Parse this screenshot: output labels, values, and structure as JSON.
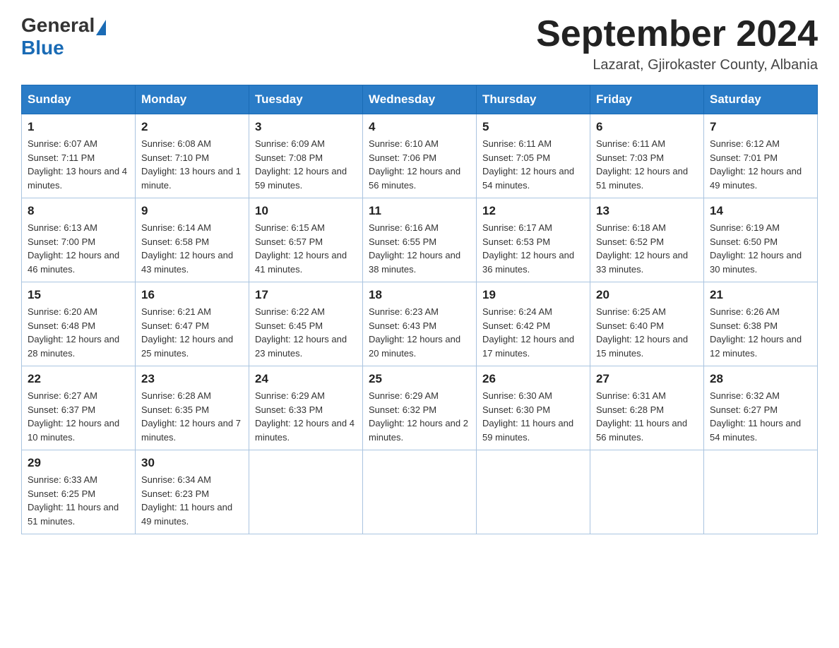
{
  "header": {
    "logo": {
      "general": "General",
      "blue": "Blue"
    },
    "title": "September 2024",
    "location": "Lazarat, Gjirokaster County, Albania"
  },
  "calendar": {
    "days": [
      "Sunday",
      "Monday",
      "Tuesday",
      "Wednesday",
      "Thursday",
      "Friday",
      "Saturday"
    ],
    "weeks": [
      [
        {
          "day": "1",
          "sunrise": "6:07 AM",
          "sunset": "7:11 PM",
          "daylight": "13 hours and 4 minutes."
        },
        {
          "day": "2",
          "sunrise": "6:08 AM",
          "sunset": "7:10 PM",
          "daylight": "13 hours and 1 minute."
        },
        {
          "day": "3",
          "sunrise": "6:09 AM",
          "sunset": "7:08 PM",
          "daylight": "12 hours and 59 minutes."
        },
        {
          "day": "4",
          "sunrise": "6:10 AM",
          "sunset": "7:06 PM",
          "daylight": "12 hours and 56 minutes."
        },
        {
          "day": "5",
          "sunrise": "6:11 AM",
          "sunset": "7:05 PM",
          "daylight": "12 hours and 54 minutes."
        },
        {
          "day": "6",
          "sunrise": "6:11 AM",
          "sunset": "7:03 PM",
          "daylight": "12 hours and 51 minutes."
        },
        {
          "day": "7",
          "sunrise": "6:12 AM",
          "sunset": "7:01 PM",
          "daylight": "12 hours and 49 minutes."
        }
      ],
      [
        {
          "day": "8",
          "sunrise": "6:13 AM",
          "sunset": "7:00 PM",
          "daylight": "12 hours and 46 minutes."
        },
        {
          "day": "9",
          "sunrise": "6:14 AM",
          "sunset": "6:58 PM",
          "daylight": "12 hours and 43 minutes."
        },
        {
          "day": "10",
          "sunrise": "6:15 AM",
          "sunset": "6:57 PM",
          "daylight": "12 hours and 41 minutes."
        },
        {
          "day": "11",
          "sunrise": "6:16 AM",
          "sunset": "6:55 PM",
          "daylight": "12 hours and 38 minutes."
        },
        {
          "day": "12",
          "sunrise": "6:17 AM",
          "sunset": "6:53 PM",
          "daylight": "12 hours and 36 minutes."
        },
        {
          "day": "13",
          "sunrise": "6:18 AM",
          "sunset": "6:52 PM",
          "daylight": "12 hours and 33 minutes."
        },
        {
          "day": "14",
          "sunrise": "6:19 AM",
          "sunset": "6:50 PM",
          "daylight": "12 hours and 30 minutes."
        }
      ],
      [
        {
          "day": "15",
          "sunrise": "6:20 AM",
          "sunset": "6:48 PM",
          "daylight": "12 hours and 28 minutes."
        },
        {
          "day": "16",
          "sunrise": "6:21 AM",
          "sunset": "6:47 PM",
          "daylight": "12 hours and 25 minutes."
        },
        {
          "day": "17",
          "sunrise": "6:22 AM",
          "sunset": "6:45 PM",
          "daylight": "12 hours and 23 minutes."
        },
        {
          "day": "18",
          "sunrise": "6:23 AM",
          "sunset": "6:43 PM",
          "daylight": "12 hours and 20 minutes."
        },
        {
          "day": "19",
          "sunrise": "6:24 AM",
          "sunset": "6:42 PM",
          "daylight": "12 hours and 17 minutes."
        },
        {
          "day": "20",
          "sunrise": "6:25 AM",
          "sunset": "6:40 PM",
          "daylight": "12 hours and 15 minutes."
        },
        {
          "day": "21",
          "sunrise": "6:26 AM",
          "sunset": "6:38 PM",
          "daylight": "12 hours and 12 minutes."
        }
      ],
      [
        {
          "day": "22",
          "sunrise": "6:27 AM",
          "sunset": "6:37 PM",
          "daylight": "12 hours and 10 minutes."
        },
        {
          "day": "23",
          "sunrise": "6:28 AM",
          "sunset": "6:35 PM",
          "daylight": "12 hours and 7 minutes."
        },
        {
          "day": "24",
          "sunrise": "6:29 AM",
          "sunset": "6:33 PM",
          "daylight": "12 hours and 4 minutes."
        },
        {
          "day": "25",
          "sunrise": "6:29 AM",
          "sunset": "6:32 PM",
          "daylight": "12 hours and 2 minutes."
        },
        {
          "day": "26",
          "sunrise": "6:30 AM",
          "sunset": "6:30 PM",
          "daylight": "11 hours and 59 minutes."
        },
        {
          "day": "27",
          "sunrise": "6:31 AM",
          "sunset": "6:28 PM",
          "daylight": "11 hours and 56 minutes."
        },
        {
          "day": "28",
          "sunrise": "6:32 AM",
          "sunset": "6:27 PM",
          "daylight": "11 hours and 54 minutes."
        }
      ],
      [
        {
          "day": "29",
          "sunrise": "6:33 AM",
          "sunset": "6:25 PM",
          "daylight": "11 hours and 51 minutes."
        },
        {
          "day": "30",
          "sunrise": "6:34 AM",
          "sunset": "6:23 PM",
          "daylight": "11 hours and 49 minutes."
        },
        null,
        null,
        null,
        null,
        null
      ]
    ]
  }
}
